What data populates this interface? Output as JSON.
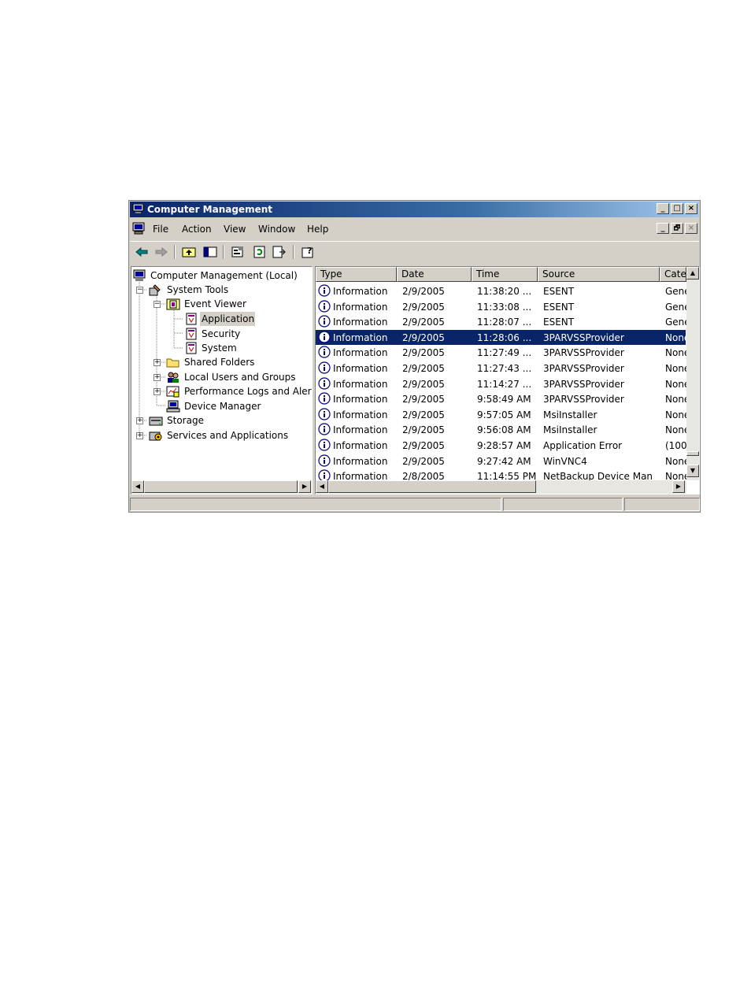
{
  "window": {
    "title": "Computer Management",
    "controls": {
      "minimize": "_",
      "maximize": "□",
      "close": "×",
      "restore": "🗗"
    }
  },
  "menu": [
    {
      "label": "File"
    },
    {
      "label": "Action"
    },
    {
      "label": "View"
    },
    {
      "label": "Window"
    },
    {
      "label": "Help"
    }
  ],
  "tree": {
    "root": "Computer Management (Local)",
    "items": [
      {
        "label": "System Tools",
        "icon": "tools-icon"
      },
      {
        "label": "Event Viewer",
        "icon": "event-viewer-icon"
      },
      {
        "label": "Application",
        "icon": "log-icon",
        "selected": true
      },
      {
        "label": "Security",
        "icon": "log-icon"
      },
      {
        "label": "System",
        "icon": "log-icon"
      },
      {
        "label": "Shared Folders",
        "icon": "folder-icon"
      },
      {
        "label": "Local Users and Groups",
        "icon": "users-icon"
      },
      {
        "label": "Performance Logs and Alerts",
        "icon": "performance-icon"
      },
      {
        "label": "Device Manager",
        "icon": "device-manager-icon"
      },
      {
        "label": "Storage",
        "icon": "storage-icon"
      },
      {
        "label": "Services and Applications",
        "icon": "services-icon"
      }
    ]
  },
  "list": {
    "columns": [
      "Type",
      "Date",
      "Time",
      "Source",
      "Cate"
    ],
    "rows": [
      {
        "type": "Information",
        "date": "2/9/2005",
        "time": "11:38:20 ...",
        "source": "ESENT",
        "category": "Gene"
      },
      {
        "type": "Information",
        "date": "2/9/2005",
        "time": "11:33:08 ...",
        "source": "ESENT",
        "category": "Gene"
      },
      {
        "type": "Information",
        "date": "2/9/2005",
        "time": "11:28:07 ...",
        "source": "ESENT",
        "category": "Gene"
      },
      {
        "type": "Information",
        "date": "2/9/2005",
        "time": "11:28:06 ...",
        "source": "3PARVSSProvider",
        "category": "None",
        "selected": true
      },
      {
        "type": "Information",
        "date": "2/9/2005",
        "time": "11:27:49 ...",
        "source": "3PARVSSProvider",
        "category": "None"
      },
      {
        "type": "Information",
        "date": "2/9/2005",
        "time": "11:27:43 ...",
        "source": "3PARVSSProvider",
        "category": "None"
      },
      {
        "type": "Information",
        "date": "2/9/2005",
        "time": "11:14:27 ...",
        "source": "3PARVSSProvider",
        "category": "None"
      },
      {
        "type": "Information",
        "date": "2/9/2005",
        "time": "9:58:49 AM",
        "source": "3PARVSSProvider",
        "category": "None"
      },
      {
        "type": "Information",
        "date": "2/9/2005",
        "time": "9:57:05 AM",
        "source": "MsiInstaller",
        "category": "None"
      },
      {
        "type": "Information",
        "date": "2/9/2005",
        "time": "9:56:08 AM",
        "source": "MsiInstaller",
        "category": "None"
      },
      {
        "type": "Information",
        "date": "2/9/2005",
        "time": "9:28:57 AM",
        "source": "Application Error",
        "category": "(100"
      },
      {
        "type": "Information",
        "date": "2/9/2005",
        "time": "9:27:42 AM",
        "source": "WinVNC4",
        "category": "None"
      },
      {
        "type": "Information",
        "date": "2/8/2005",
        "time": "11:14:55 PM",
        "source": "NetBackup Device Man",
        "category": "None"
      }
    ]
  },
  "colors": {
    "titlebar_start": "#0a246a",
    "titlebar_end": "#a6caf0",
    "selection": "#0a246a",
    "chrome": "#d4d0c8"
  }
}
